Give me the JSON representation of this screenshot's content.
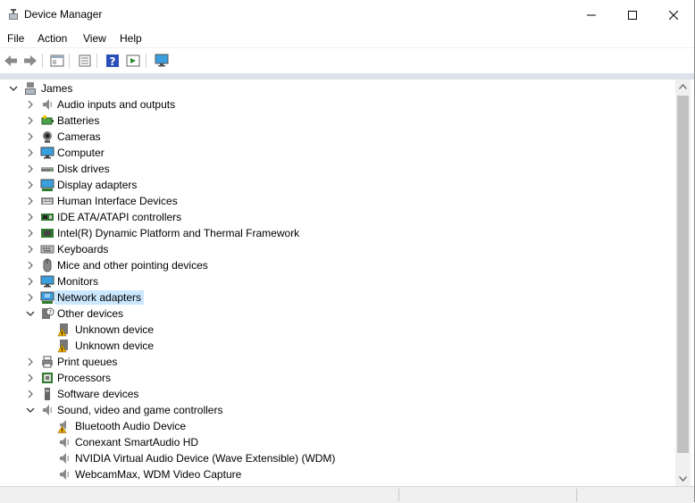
{
  "window": {
    "title": "Device Manager"
  },
  "menu": [
    "File",
    "Action",
    "View",
    "Help"
  ],
  "toolbar": {
    "buttons": [
      "back-icon",
      "forward-icon",
      "properties-pane-icon",
      "device-list-icon",
      "help-icon",
      "run-action-icon",
      "monitor-icon"
    ]
  },
  "tree": {
    "root": "James",
    "nodes": [
      {
        "label": "Audio inputs and outputs",
        "icon": "speaker-icon",
        "expanded": false,
        "level": 1
      },
      {
        "label": "Batteries",
        "icon": "battery-icon",
        "expanded": false,
        "level": 1
      },
      {
        "label": "Cameras",
        "icon": "camera-icon",
        "expanded": false,
        "level": 1
      },
      {
        "label": "Computer",
        "icon": "computer-icon",
        "expanded": false,
        "level": 1
      },
      {
        "label": "Disk drives",
        "icon": "disk-drive-icon",
        "expanded": false,
        "level": 1
      },
      {
        "label": "Display adapters",
        "icon": "display-adapter-icon",
        "expanded": false,
        "level": 1
      },
      {
        "label": "Human Interface Devices",
        "icon": "hid-icon",
        "expanded": false,
        "level": 1
      },
      {
        "label": "IDE ATA/ATAPI controllers",
        "icon": "ide-controller-icon",
        "expanded": false,
        "level": 1
      },
      {
        "label": "Intel(R) Dynamic Platform and Thermal Framework",
        "icon": "chip-icon",
        "expanded": false,
        "level": 1
      },
      {
        "label": "Keyboards",
        "icon": "keyboard-icon",
        "expanded": false,
        "level": 1
      },
      {
        "label": "Mice and other pointing devices",
        "icon": "mouse-icon",
        "expanded": false,
        "level": 1
      },
      {
        "label": "Monitors",
        "icon": "monitor-icon",
        "expanded": false,
        "level": 1
      },
      {
        "label": "Network adapters",
        "icon": "network-adapter-icon",
        "expanded": false,
        "level": 1,
        "selected": true
      },
      {
        "label": "Other devices",
        "icon": "unknown-device-icon",
        "expanded": true,
        "level": 1
      },
      {
        "label": "Unknown device",
        "icon": "warning-device-icon",
        "level": 2
      },
      {
        "label": "Unknown device",
        "icon": "warning-device-icon",
        "level": 2
      },
      {
        "label": "Print queues",
        "icon": "printer-icon",
        "expanded": false,
        "level": 1
      },
      {
        "label": "Processors",
        "icon": "processor-icon",
        "expanded": false,
        "level": 1
      },
      {
        "label": "Software devices",
        "icon": "software-device-icon",
        "expanded": false,
        "level": 1
      },
      {
        "label": "Sound, video and game controllers",
        "icon": "speaker-icon",
        "expanded": true,
        "level": 1
      },
      {
        "label": "Bluetooth Audio Device",
        "icon": "warning-speaker-icon",
        "level": 2
      },
      {
        "label": "Conexant SmartAudio HD",
        "icon": "speaker-icon",
        "level": 2
      },
      {
        "label": "NVIDIA Virtual Audio Device (Wave Extensible) (WDM)",
        "icon": "speaker-icon",
        "level": 2
      },
      {
        "label": "WebcamMax, WDM Video Capture",
        "icon": "speaker-icon",
        "level": 2
      }
    ]
  },
  "colors": {
    "selection": "#cce8ff",
    "accent": "#0078d7",
    "warning": "#f2b200"
  }
}
